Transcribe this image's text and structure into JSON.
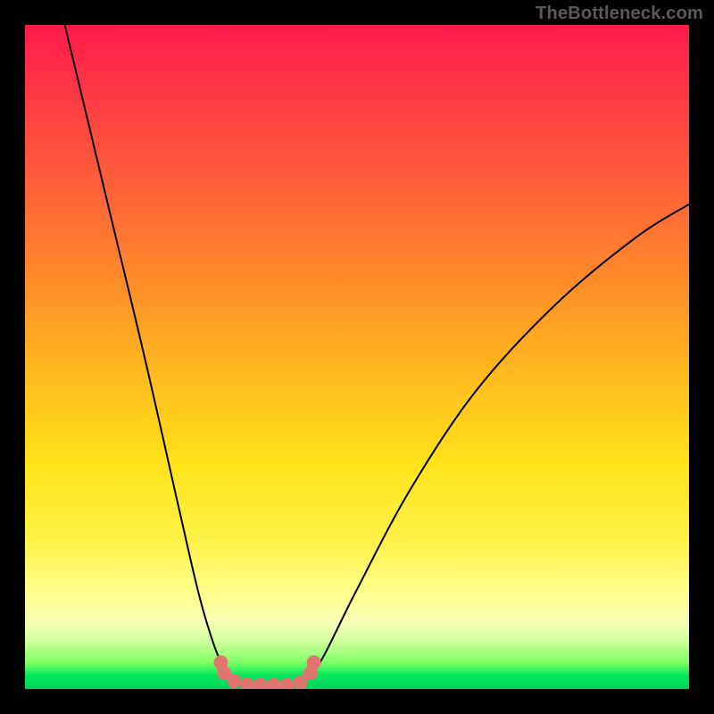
{
  "watermark": {
    "text": "TheBottleneck.com"
  },
  "colors": {
    "frame": "#000000",
    "curve_stroke": "#000000",
    "marker_fill": "#e0746f",
    "gradient_stops": [
      "#ff1a4d",
      "#ff5a3c",
      "#ffb81f",
      "#fff24a",
      "#ffff91",
      "#00d45a"
    ]
  },
  "chart_data": {
    "type": "line",
    "title": "",
    "xlabel": "",
    "ylabel": "",
    "xlim": [
      0,
      100
    ],
    "ylim": [
      0,
      100
    ],
    "grid": false,
    "legend": false,
    "series": [
      {
        "name": "bottleneck-curve-left",
        "x": [
          6,
          12,
          18,
          23,
          26,
          28,
          29.5,
          30.5,
          31.5,
          33
        ],
        "y": [
          100,
          75,
          50,
          28,
          15,
          8,
          4,
          2.2,
          1.2,
          0.8
        ]
      },
      {
        "name": "bottleneck-curve-right",
        "x": [
          41,
          43,
          45,
          50,
          58,
          68,
          80,
          92,
          100
        ],
        "y": [
          0.8,
          2.2,
          5,
          15,
          30,
          45,
          58,
          68,
          73
        ]
      },
      {
        "name": "bottleneck-curve-floor",
        "x": [
          33,
          35,
          37,
          39,
          41
        ],
        "y": [
          0.8,
          0.5,
          0.5,
          0.5,
          0.8
        ]
      }
    ],
    "markers": {
      "name": "highlight-points",
      "points": [
        {
          "x": 29.5,
          "y": 4.0
        },
        {
          "x": 30.0,
          "y": 2.4
        },
        {
          "x": 31.5,
          "y": 1.2
        },
        {
          "x": 33.5,
          "y": 0.7
        },
        {
          "x": 35.5,
          "y": 0.6
        },
        {
          "x": 37.5,
          "y": 0.6
        },
        {
          "x": 39.5,
          "y": 0.6
        },
        {
          "x": 41.5,
          "y": 1.0
        },
        {
          "x": 43.0,
          "y": 2.4
        },
        {
          "x": 43.5,
          "y": 4.0
        }
      ]
    }
  }
}
